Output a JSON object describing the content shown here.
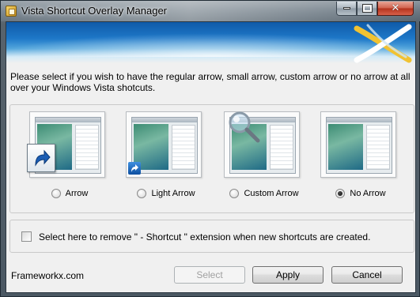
{
  "window": {
    "title": "Vista Shortcut Overlay Manager",
    "close_glyph": "✕"
  },
  "instructions": "Please select if you wish to have the regular arrow, small arrow, custom arrow or no arrow at all over your Windows Vista shotcuts.",
  "options": [
    {
      "label": "Arrow",
      "selected": false,
      "overlay": "large-shortcut-arrow"
    },
    {
      "label": "Light Arrow",
      "selected": false,
      "overlay": "small-shortcut-arrow"
    },
    {
      "label": "Custom Arrow",
      "selected": false,
      "overlay": "magnifier"
    },
    {
      "label": "No Arrow",
      "selected": true,
      "overlay": "none"
    }
  ],
  "checkbox": {
    "label": "Select here to remove \" - Shortcut \" extension when new shortcuts are created.",
    "checked": false
  },
  "footer": {
    "link": "Frameworkx.com"
  },
  "buttons": {
    "select": "Select",
    "apply": "Apply",
    "cancel": "Cancel"
  },
  "colors": {
    "banner_blue": "#1e78c8",
    "selected_radio": "#111111",
    "disabled_text": "#a0a0a0"
  }
}
